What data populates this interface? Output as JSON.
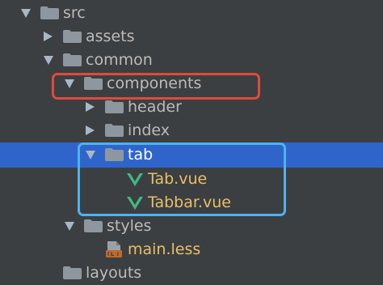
{
  "tree": {
    "items": [
      {
        "label": "src",
        "kind": "folder",
        "state": "expanded",
        "icon": "folder-icon"
      },
      {
        "label": "assets",
        "kind": "folder",
        "state": "collapsed",
        "icon": "folder-icon"
      },
      {
        "label": "common",
        "kind": "folder",
        "state": "expanded",
        "icon": "folder-icon"
      },
      {
        "label": "components",
        "kind": "folder",
        "state": "expanded",
        "icon": "folder-icon"
      },
      {
        "label": "header",
        "kind": "folder",
        "state": "collapsed",
        "icon": "folder-icon"
      },
      {
        "label": "index",
        "kind": "folder",
        "state": "collapsed",
        "icon": "folder-icon"
      },
      {
        "label": "tab",
        "kind": "folder",
        "state": "expanded",
        "icon": "folder-icon",
        "selected": true
      },
      {
        "label": "Tab.vue",
        "kind": "file",
        "icon": "vue-file-icon"
      },
      {
        "label": "Tabbar.vue",
        "kind": "file",
        "icon": "vue-file-icon"
      },
      {
        "label": "styles",
        "kind": "folder",
        "state": "expanded",
        "icon": "folder-icon"
      },
      {
        "label": "main.less",
        "kind": "file",
        "icon": "less-file-icon"
      },
      {
        "label": "layouts",
        "kind": "folder",
        "state": "collapsed",
        "icon": "folder-icon"
      }
    ]
  },
  "colors": {
    "background": "#3c3f41",
    "selection": "#2f65ca",
    "folder": "#8e979f",
    "vue_icon": "#41b883",
    "file_label": "#e8bf6a",
    "less_icon": "#c0692d",
    "highlight_red": "#e04a3c",
    "highlight_blue": "#4db3f0"
  }
}
